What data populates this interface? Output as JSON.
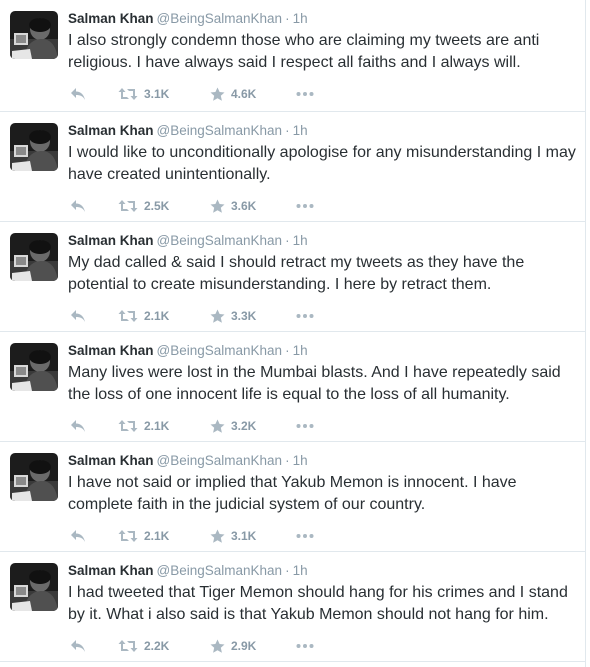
{
  "colors": {
    "text": "#292f33",
    "meta": "#8899a6",
    "action": "#aab8c2",
    "divider": "#e1e8ed"
  },
  "icons": {
    "reply": "reply-icon",
    "retweet": "retweet-icon",
    "favorite": "star-icon",
    "more": "more-dots-icon"
  },
  "tweets": [
    {
      "name": "Salman Khan",
      "handle": "@BeingSalmanKhan",
      "separator": "·",
      "time": "1h",
      "text": "I also strongly condemn those who are claiming my tweets are anti religious. I have always said I respect all faiths and I always will.",
      "retweets": "3.1K",
      "favorites": "4.6K"
    },
    {
      "name": "Salman Khan",
      "handle": "@BeingSalmanKhan",
      "separator": "·",
      "time": "1h",
      "text": "I would like to unconditionally apologise for any misunderstanding I may have created unintentionally.",
      "retweets": "2.5K",
      "favorites": "3.6K"
    },
    {
      "name": "Salman Khan",
      "handle": "@BeingSalmanKhan",
      "separator": "·",
      "time": "1h",
      "text": "My dad called & said I should retract my tweets as they have the potential to create misunderstanding. I here by retract them.",
      "retweets": "2.1K",
      "favorites": "3.3K"
    },
    {
      "name": "Salman Khan",
      "handle": "@BeingSalmanKhan",
      "separator": "·",
      "time": "1h",
      "text": "Many lives were lost in the Mumbai blasts. And I have repeatedly said the loss of one innocent life is equal to the loss of all humanity.",
      "retweets": "2.1K",
      "favorites": "3.2K"
    },
    {
      "name": "Salman Khan",
      "handle": "@BeingSalmanKhan",
      "separator": "·",
      "time": "1h",
      "text": "I have not said or implied that Yakub Memon is innocent. I have complete faith in the judicial system of our country.",
      "retweets": "2.1K",
      "favorites": "3.1K"
    },
    {
      "name": "Salman Khan",
      "handle": "@BeingSalmanKhan",
      "separator": "·",
      "time": "1h",
      "text": "I had tweeted that Tiger Memon should hang for his crimes and I stand by it. What i also said is that Yakub Memon should not hang for him.",
      "retweets": "2.2K",
      "favorites": "2.9K"
    }
  ]
}
